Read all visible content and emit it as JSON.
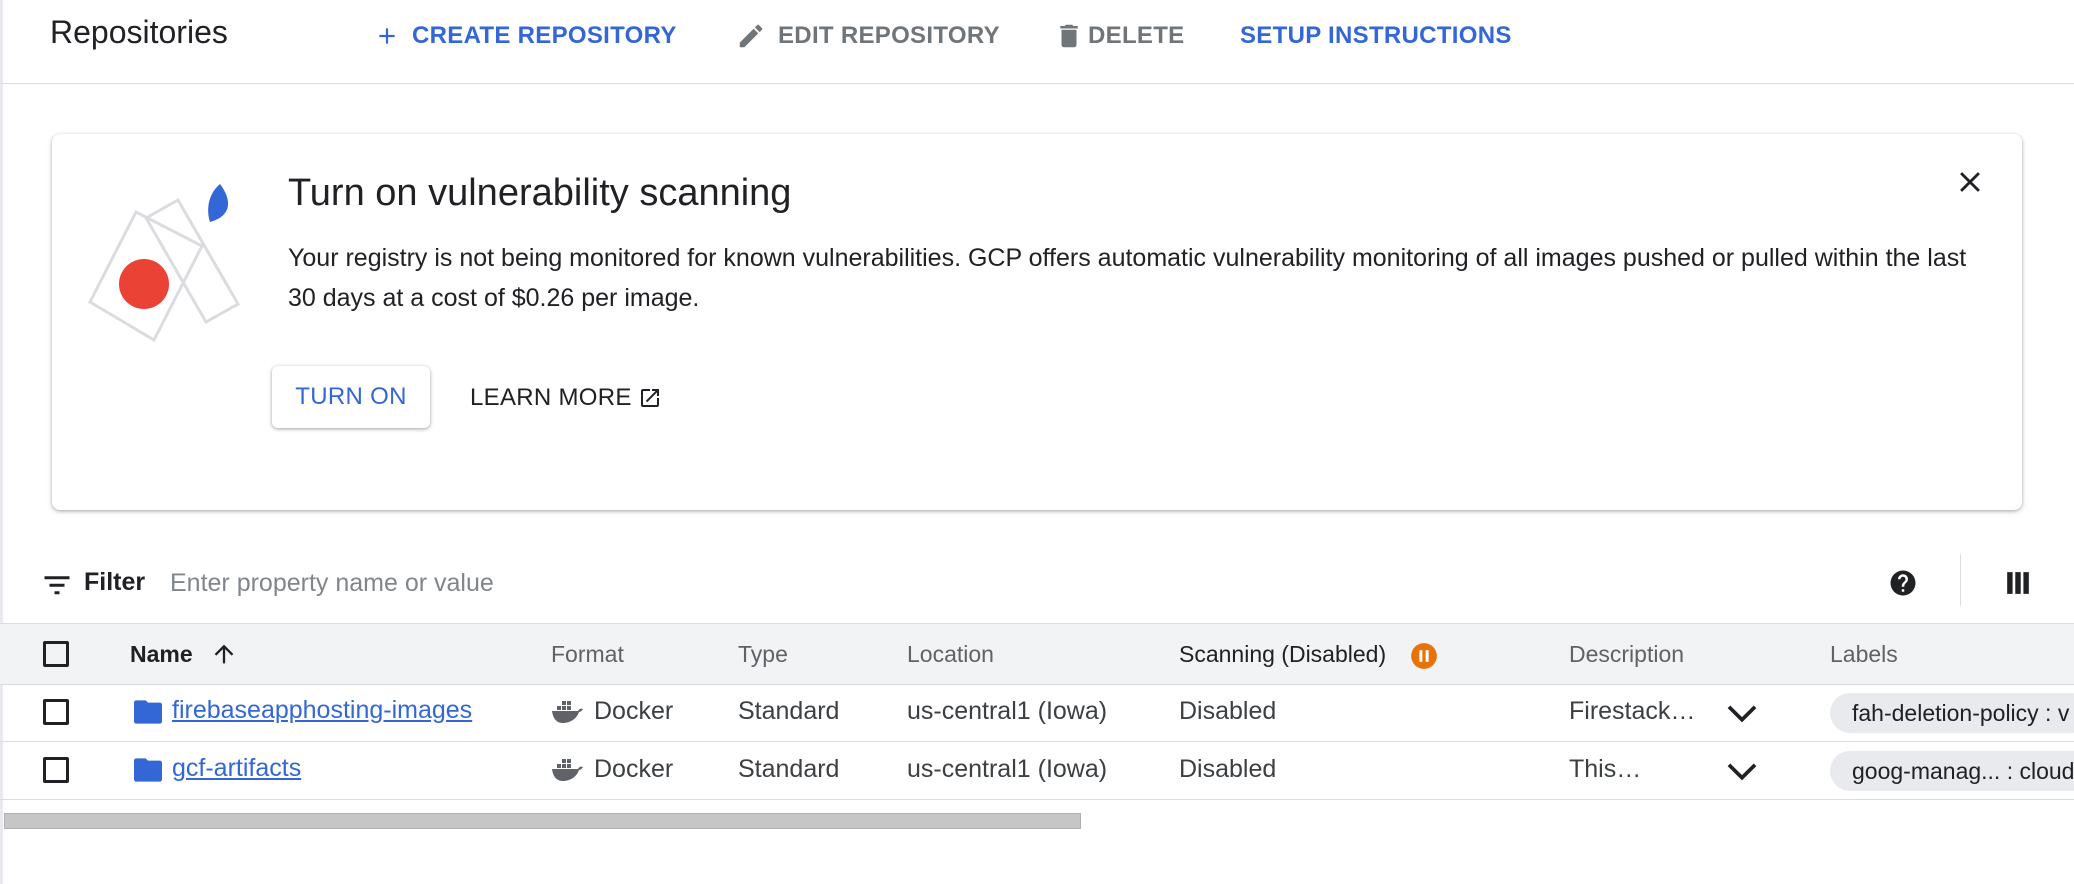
{
  "header": {
    "title": "Repositories",
    "actions": {
      "create": "CREATE REPOSITORY",
      "edit": "EDIT REPOSITORY",
      "delete": "DELETE",
      "setup": "SETUP INSTRUCTIONS"
    }
  },
  "banner": {
    "title": "Turn on vulnerability scanning",
    "body": "Your registry is not being monitored for known vulnerabilities. GCP offers automatic vulnerability monitoring of all images pushed or pulled within the last 30 days at a cost of $0.26 per image.",
    "turn_on_label": "TURN ON",
    "learn_more_label": "LEARN MORE"
  },
  "filter": {
    "label": "Filter",
    "placeholder": "Enter property name or value"
  },
  "table": {
    "columns": {
      "name": "Name",
      "format": "Format",
      "type": "Type",
      "location": "Location",
      "scanning": "Scanning (Disabled)",
      "description": "Description",
      "labels": "Labels"
    },
    "sort": {
      "column": "Name",
      "direction": "ascending"
    },
    "rows": [
      {
        "name": "firebaseapphosting-images",
        "format": "Docker",
        "type": "Standard",
        "location": "us-central1 (Iowa)",
        "scanning": "Disabled",
        "description": "Firestack…",
        "label": "fah-deletion-policy : v"
      },
      {
        "name": "gcf-artifacts",
        "format": "Docker",
        "type": "Standard",
        "location": "us-central1 (Iowa)",
        "scanning": "Disabled",
        "description": "This…",
        "label": "goog-manag... : cloud"
      }
    ]
  },
  "colors": {
    "accent_blue": "#3367d6",
    "scanning_paused": "#e8710a",
    "illustration_red": "#ea4335"
  },
  "icons": [
    "plus-icon",
    "pencil-icon",
    "trash-icon",
    "close-icon",
    "external-link-icon",
    "filter-icon",
    "help-icon",
    "columns-icon",
    "sort-arrow-up-icon",
    "pause-icon",
    "folder-icon",
    "docker-icon",
    "chevron-down-icon"
  ]
}
